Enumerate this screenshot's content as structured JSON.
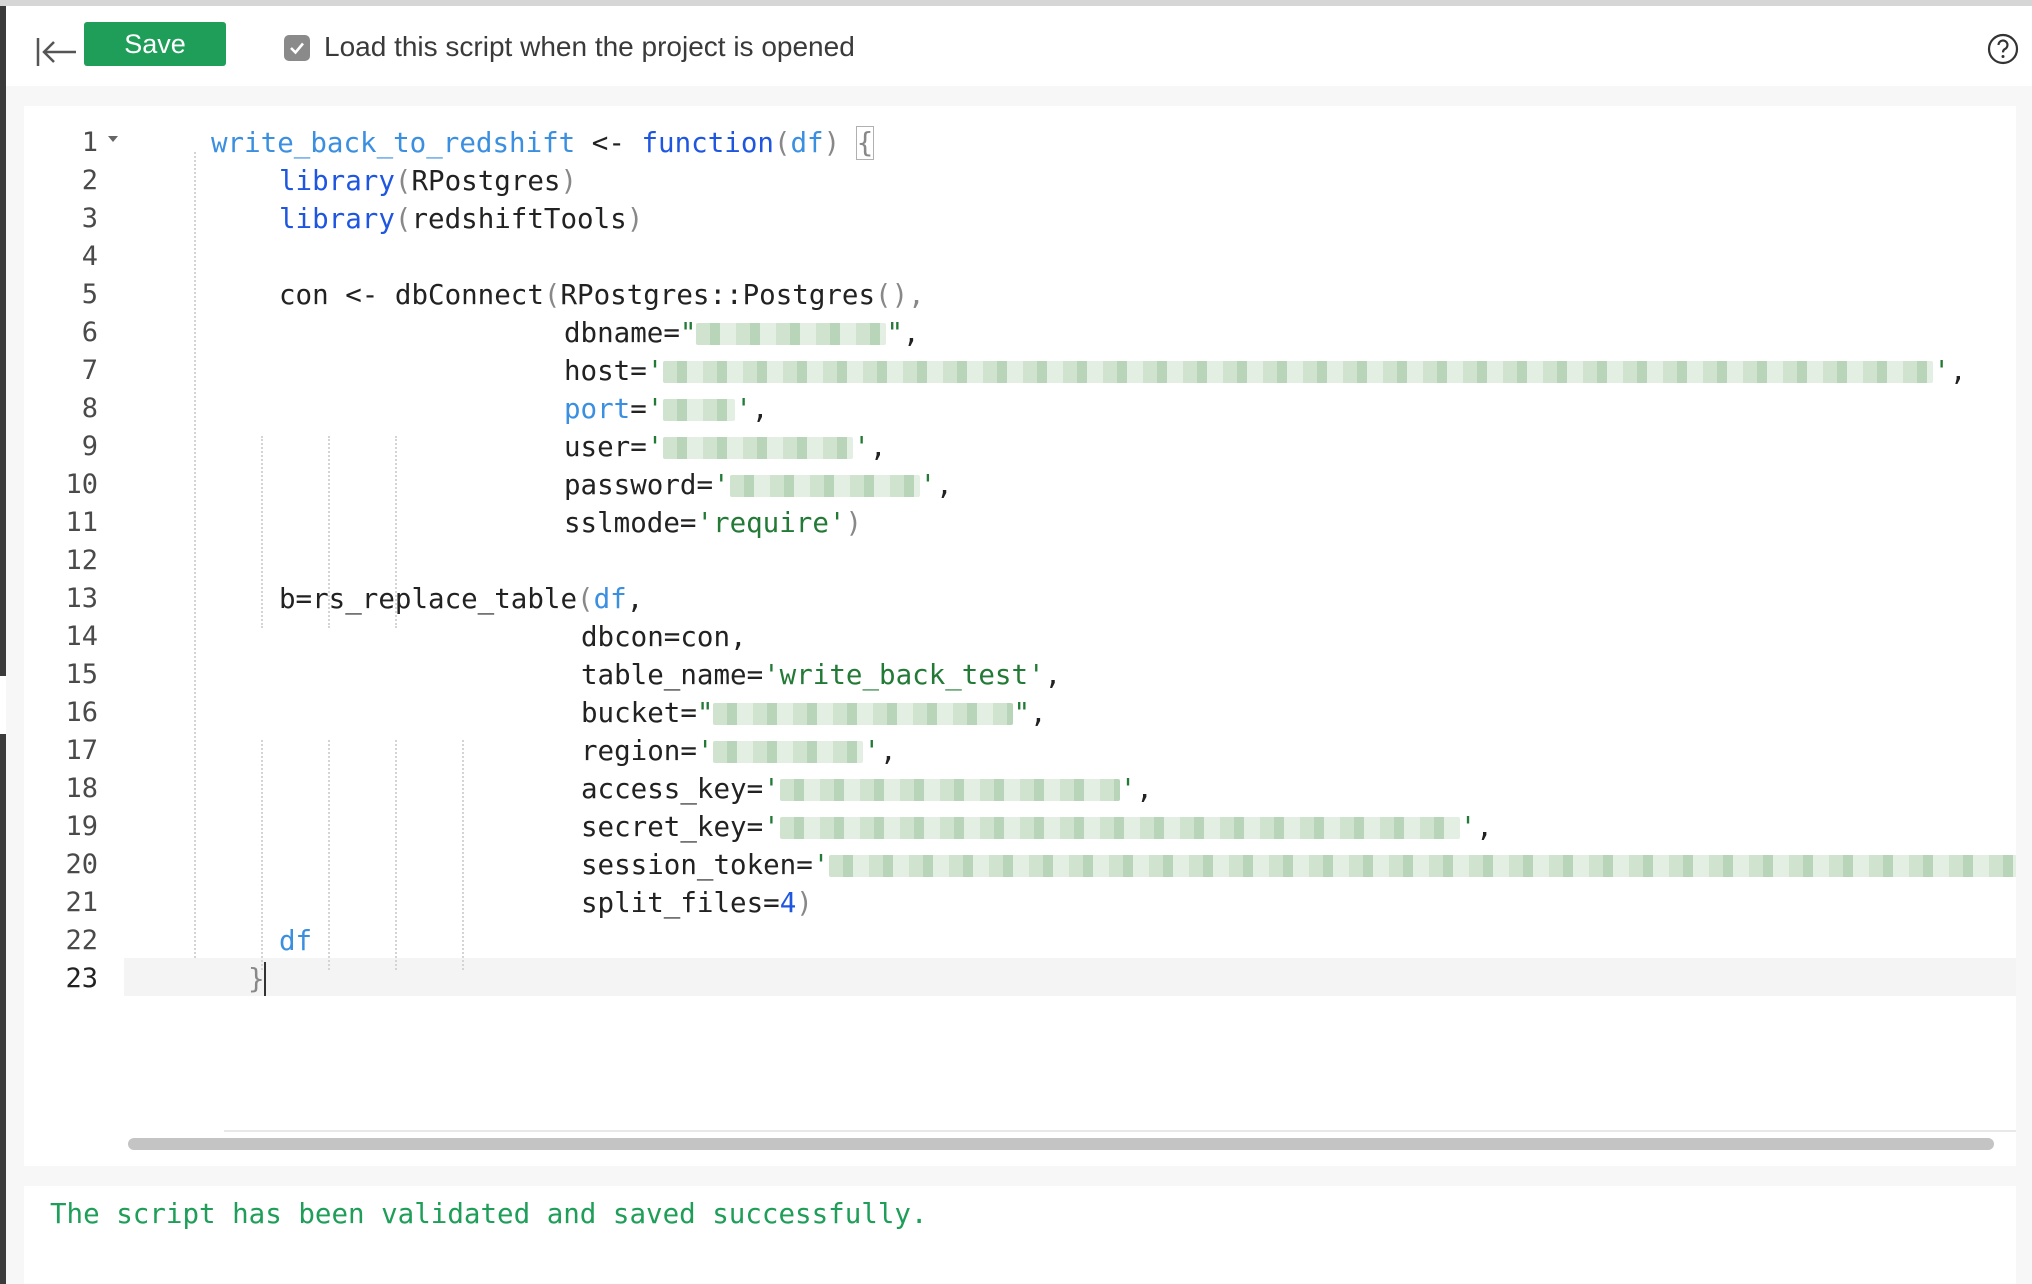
{
  "toolbar": {
    "save_label": "Save",
    "load_on_open_label": "Load this script when the project is opened",
    "load_on_open_checked": true
  },
  "editor": {
    "line_numbers": [
      "1",
      "2",
      "3",
      "4",
      "5",
      "6",
      "7",
      "8",
      "9",
      "10",
      "11",
      "12",
      "13",
      "14",
      "15",
      "16",
      "17",
      "18",
      "19",
      "20",
      "21",
      "22",
      "23"
    ],
    "active_line": "23",
    "code": {
      "l1_name": "write_back_to_redshift",
      "l1_assign": " <- ",
      "l1_kw": "function",
      "l1_open": "(",
      "l1_arg": "df",
      "l1_close": ") ",
      "l1_brace": "{",
      "l2_fn": "library",
      "l2_arg": "RPostgres",
      "l3_fn": "library",
      "l3_arg": "redshiftTools",
      "l5_text": "con <- dbConnect",
      "l5_arg": "RPostgres::Postgres",
      "l6_key": "dbname=",
      "l7_key": "host=",
      "l8_key": "port",
      "l9_key": "user=",
      "l10_key": "password=",
      "l11_key": "sslmode=",
      "l11_val": "'require'",
      "l13_text": "b=rs_replace_table",
      "l13_arg": "df",
      "l14_text": "dbcon=con,",
      "l15_key": "table_name=",
      "l15_val": "'write_back_test'",
      "l16_key": "bucket=",
      "l17_key": "region=",
      "l18_key": "access_key=",
      "l19_key": "secret_key=",
      "l20_key": "session_token=",
      "l21_key": "split_files=",
      "l21_val": "4",
      "l22_text": "df",
      "l23_text": "}"
    }
  },
  "status": {
    "message": "The script has been validated and saved successfully."
  },
  "colors": {
    "save_button": "#1e9e58",
    "status_text": "#1e9e58",
    "keyword": "#1f56e0",
    "function_name": "#3b8fe0",
    "string": "#237a36"
  },
  "icons": {
    "collapse": "collapse-left-icon",
    "checkbox": "checkmark-icon",
    "help": "help-circle-icon"
  }
}
